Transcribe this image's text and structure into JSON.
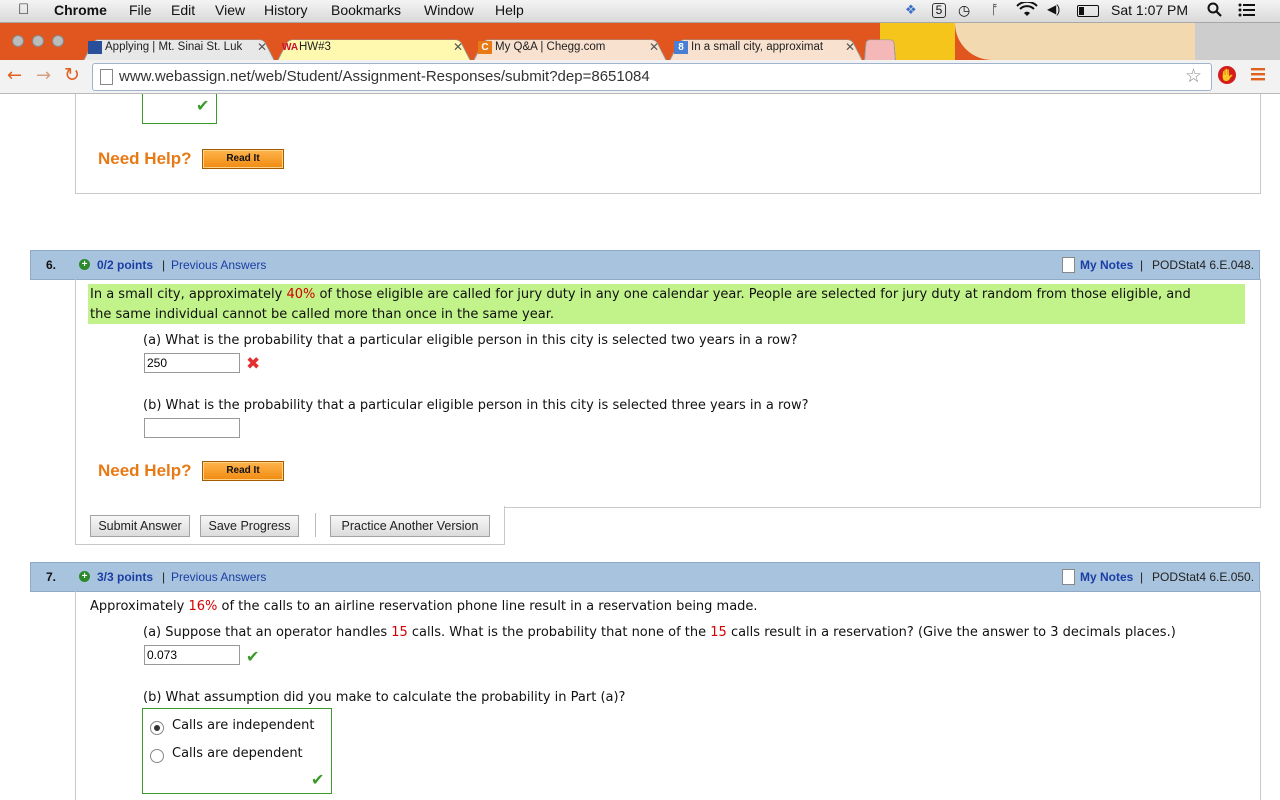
{
  "menubar": {
    "app_name": "Chrome",
    "menus": [
      "File",
      "Edit",
      "View",
      "History",
      "Bookmarks",
      "Window",
      "Help"
    ],
    "clock": "Sat 1:07 PM"
  },
  "tabs": [
    {
      "title": "Applying | Mt. Sinai St. Luk",
      "favicon": "site-icon",
      "color": "#2a4f9a"
    },
    {
      "title": "HW#3",
      "favicon": "WA",
      "color": "#c8102e"
    },
    {
      "title": "My Q&A | Chegg.com",
      "favicon": "C",
      "color": "#e87a16"
    },
    {
      "title": "In a small city, approximat",
      "favicon": "8",
      "color": "#4a7fd4"
    }
  ],
  "toolbar": {
    "url": "www.webassign.net/web/Student/Assignment-Responses/submit?dep=8651084"
  },
  "colors": {
    "accent_orange": "#e87a16",
    "header_blue": "#a8c3dd",
    "highlight_green": "#c2f28a",
    "link_blue": "#1a3ea5"
  },
  "prev_section": {
    "need_help": "Need Help?",
    "read_it": "Read It"
  },
  "q6": {
    "number": "6.",
    "points": "0/2 points",
    "previous_answers": "Previous Answers",
    "my_notes": "My Notes",
    "ref": "PODStat4 6.E.048.",
    "text_a": "In a small city, approximately ",
    "pct": "40%",
    "text_b": " of those eligible are called for jury duty in any one calendar year. People are selected for jury duty at random from those eligible, and",
    "text_c": "the same individual cannot be called more than once in the same year.",
    "part_a_q": "(a) What is the probability that a particular eligible person in this city is selected two years in a row?",
    "part_a_value": "250",
    "part_b_q": "(b) What is the probability that a particular eligible person in this city is selected three years in a row?",
    "part_b_value": "",
    "need_help": "Need Help?",
    "read_it": "Read It",
    "submit": "Submit Answer",
    "save": "Save Progress",
    "practice": "Practice Another Version"
  },
  "q7": {
    "number": "7.",
    "points": "3/3 points",
    "previous_answers": "Previous Answers",
    "my_notes": "My Notes",
    "ref": "PODStat4 6.E.050.",
    "text_a": "Approximately ",
    "pct": "16%",
    "text_b": " of the calls to an airline reservation phone line result in a reservation being made.",
    "part_a_q1": "(a) Suppose that an operator handles ",
    "n1": "15",
    "part_a_q2": " calls. What is the probability that none of the ",
    "n2": "15",
    "part_a_q3": " calls result in a reservation? (Give the answer to 3 decimals places.)",
    "part_a_value": "0.073",
    "part_b_q": "(b) What assumption did you make to calculate the probability in Part (a)?",
    "options": [
      "Calls are independent",
      "Calls are dependent"
    ],
    "selected": "Calls are independent"
  }
}
